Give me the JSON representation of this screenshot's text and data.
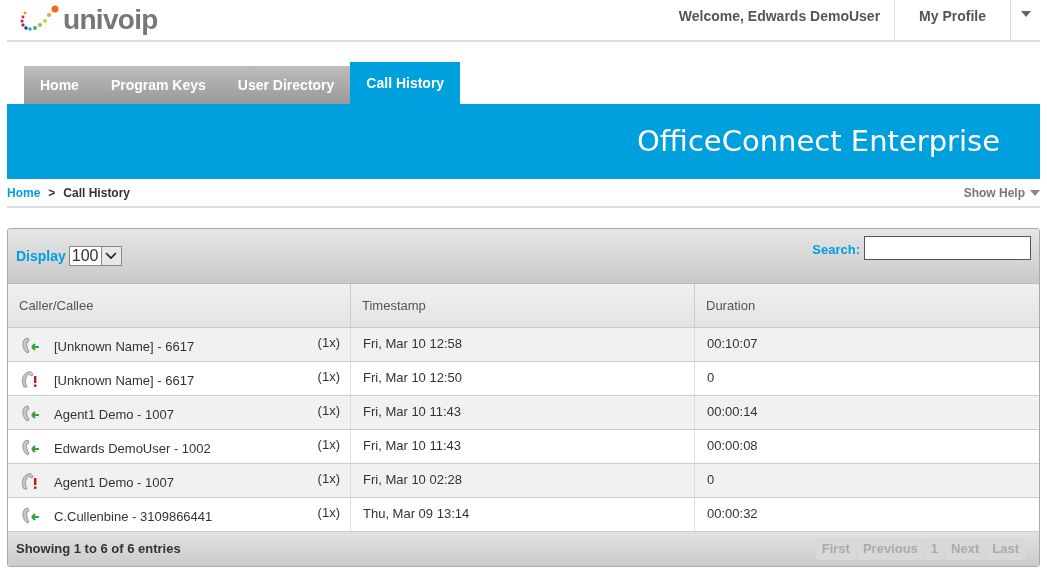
{
  "header": {
    "logo": "univoip",
    "welcome": "Welcome, Edwards DemoUser",
    "profile": "My Profile"
  },
  "tabs": [
    {
      "label": "Home",
      "selected": false
    },
    {
      "label": "Program Keys",
      "selected": false
    },
    {
      "label": "User Directory",
      "selected": false
    },
    {
      "label": "Call History",
      "selected": true
    }
  ],
  "banner": {
    "title": "OfficeConnect Enterprise"
  },
  "breadcrumb": {
    "items": [
      "Home",
      "Call History"
    ],
    "separator": ">",
    "help": "Show Help"
  },
  "toolbar": {
    "display_label": "Display",
    "display_value": "100",
    "search_label": "Search:"
  },
  "table": {
    "columns": [
      "Caller/Callee",
      "Timestamp",
      "Duration"
    ],
    "rows": [
      {
        "kind": "incoming",
        "caller": "[Unknown Name] - 6617",
        "count": "(1x)",
        "timestamp": "Fri, Mar 10 12:58",
        "duration": "00:10:07"
      },
      {
        "kind": "missed",
        "caller": "[Unknown Name] - 6617",
        "count": "(1x)",
        "timestamp": "Fri, Mar 10 12:50",
        "duration": "0"
      },
      {
        "kind": "incoming",
        "caller": "Agent1 Demo - 1007",
        "count": "(1x)",
        "timestamp": "Fri, Mar 10 11:43",
        "duration": "00:00:14"
      },
      {
        "kind": "incoming",
        "caller": "Edwards DemoUser - 1002",
        "count": "(1x)",
        "timestamp": "Fri, Mar 10 11:43",
        "duration": "00:00:08"
      },
      {
        "kind": "missed",
        "caller": "Agent1 Demo - 1007",
        "count": "(1x)",
        "timestamp": "Fri, Mar 10 02:28",
        "duration": "0"
      },
      {
        "kind": "incoming",
        "caller": "C.Cullenbine - 3109866441",
        "count": "(1x)",
        "timestamp": "Thu, Mar 09 13:14",
        "duration": "00:00:32"
      }
    ]
  },
  "footer": {
    "info": "Showing 1 to 6 of 6 entries",
    "pages": [
      {
        "label": "First",
        "disabled": true
      },
      {
        "label": "Previous",
        "disabled": true
      },
      {
        "label": "1",
        "disabled": true
      },
      {
        "label": "Next",
        "disabled": true
      },
      {
        "label": "Last",
        "disabled": true
      }
    ]
  }
}
